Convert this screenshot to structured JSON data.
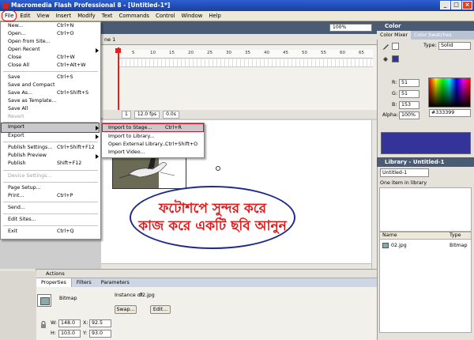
{
  "window": {
    "title": "Macromedia Flash Professional 8 - [Untitled-1*]",
    "min": "_",
    "max": "□",
    "close": "×"
  },
  "menubar": [
    "File",
    "Edit",
    "View",
    "Insert",
    "Modify",
    "Text",
    "Commands",
    "Control",
    "Window",
    "Help"
  ],
  "timeline": {
    "scene_label": "ne 1",
    "zoom": "100%",
    "frame_numbers": [
      "5",
      "10",
      "15",
      "20",
      "25",
      "30",
      "35",
      "40",
      "45",
      "50",
      "55",
      "60",
      "65"
    ],
    "status": {
      "frame": "1",
      "fps": "12.0 fps",
      "time": "0.0s"
    }
  },
  "file_menu": [
    {
      "label": "New...",
      "shortcut": "Ctrl+N"
    },
    {
      "label": "Open...",
      "shortcut": "Ctrl+O"
    },
    {
      "label": "Open from Site...",
      "shortcut": ""
    },
    {
      "label": "Open Recent",
      "shortcut": "",
      "submenu": true
    },
    {
      "label": "Close",
      "shortcut": "Ctrl+W"
    },
    {
      "label": "Close All",
      "shortcut": "Ctrl+Alt+W"
    },
    {
      "label": "Save",
      "shortcut": "Ctrl+S"
    },
    {
      "label": "Save and Compact",
      "shortcut": ""
    },
    {
      "label": "Save As...",
      "shortcut": "Ctrl+Shift+S"
    },
    {
      "label": "Save as Template...",
      "shortcut": ""
    },
    {
      "label": "Save All",
      "shortcut": ""
    },
    {
      "label": "Revert",
      "shortcut": "",
      "disabled": true
    },
    {
      "label": "Import",
      "shortcut": "",
      "submenu": true,
      "highlighted": true
    },
    {
      "label": "Export",
      "shortcut": "",
      "submenu": true
    },
    {
      "label": "Publish Settings...",
      "shortcut": "Ctrl+Shift+F12"
    },
    {
      "label": "Publish Preview",
      "shortcut": "",
      "submenu": true
    },
    {
      "label": "Publish",
      "shortcut": "Shift+F12"
    },
    {
      "label": "Device Settings...",
      "shortcut": "",
      "disabled": true
    },
    {
      "label": "Page Setup...",
      "shortcut": ""
    },
    {
      "label": "Print...",
      "shortcut": "Ctrl+P"
    },
    {
      "label": "Send...",
      "shortcut": ""
    },
    {
      "label": "Edit Sites...",
      "shortcut": ""
    },
    {
      "label": "Exit",
      "shortcut": "Ctrl+Q"
    }
  ],
  "import_menu": [
    {
      "label": "Import to Stage...",
      "shortcut": "Ctrl+R",
      "highlighted": true
    },
    {
      "label": "Import to Library...",
      "shortcut": ""
    },
    {
      "label": "Open External Library...",
      "shortcut": "Ctrl+Shift+O"
    },
    {
      "label": "Import Video...",
      "shortcut": ""
    }
  ],
  "stage": {
    "callout_line1": "ফটোশপে সুন্দর করে",
    "callout_line2": "কাজ করে একটি ছবি আনুন"
  },
  "properties": {
    "actions_label": "Actions",
    "tabs": [
      "Properties",
      "Filters",
      "Parameters"
    ],
    "type": "Bitmap",
    "instance_of_label": "Instance of:",
    "instance_of": "02.jpg",
    "swap_button": "Swap...",
    "edit_button": "Edit...",
    "w_label": "W:",
    "w": "148.0",
    "h_label": "H:",
    "h": "103.0",
    "x_label": "X:",
    "x": "92.5",
    "y_label": "Y:",
    "y": "93.0"
  },
  "color_panel": {
    "title": "Color",
    "tabs": [
      "Color Mixer",
      "Color Swatches"
    ],
    "type_label": "Type:",
    "type_value": "Solid",
    "r_label": "R:",
    "r": "51",
    "g_label": "G:",
    "g": "51",
    "b_label": "B:",
    "b": "153",
    "alpha_label": "Alpha:",
    "alpha": "100%",
    "hex": "#333399",
    "swatch_color": "#333399"
  },
  "library_panel": {
    "title": "Library - Untitled-1",
    "doc_select": "Untitled-1",
    "count_text": "One item in library",
    "col_name": "Name",
    "col_type": "Type",
    "items": [
      {
        "name": "02.jpg",
        "type": "Bitmap"
      }
    ]
  },
  "colors": {
    "accent_red": "#d11111",
    "callout_text": "#e01818",
    "callout_border": "#1d2a8a",
    "titlebar": "#2d5fd1"
  }
}
